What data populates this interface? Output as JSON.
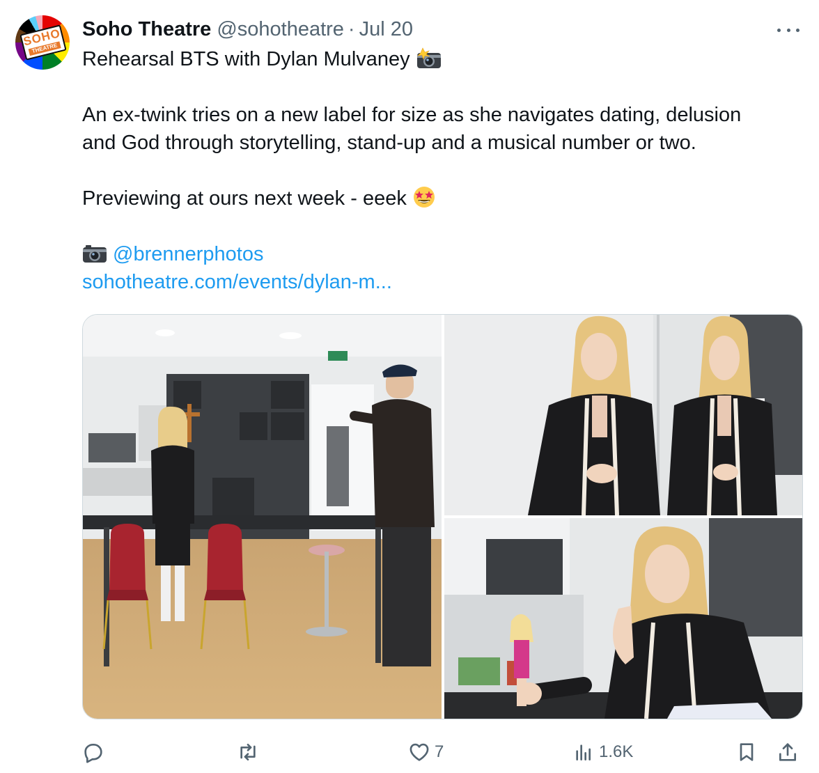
{
  "tweet": {
    "author_name": "Soho Theatre",
    "author_handle": "@sohotheatre",
    "separator": "·",
    "date": "Jul 20",
    "avatar_text_top": "SOHO",
    "avatar_text_bottom": "THEATRE",
    "line1": "Rehearsal BTS with Dylan Mulvaney",
    "line2": "An ex-twink tries on a new label for size as she navigates dating, delusion",
    "line3": "and God through storytelling, stand-up and a musical number or two.",
    "line4": "Previewing at ours next week - eeek",
    "mention": "@brennerphotos",
    "url": "sohotheatre.com/events/dylan-m...",
    "icons": {
      "line1_emoji": "camera-flash-icon",
      "line4_emoji": "star-struck-icon",
      "mention_emoji": "camera-icon"
    }
  },
  "media": {
    "photos": [
      {
        "name": "rehearsal-room-photo"
      },
      {
        "name": "mirror-portrait-photo"
      },
      {
        "name": "doll-table-photo"
      }
    ]
  },
  "actions": {
    "reply": {
      "icon": "reply-icon",
      "count": ""
    },
    "repost": {
      "icon": "repost-icon",
      "count": ""
    },
    "like": {
      "icon": "heart-icon",
      "count": "7"
    },
    "views": {
      "icon": "views-icon",
      "count": "1.6K"
    },
    "bookmark": {
      "icon": "bookmark-icon"
    },
    "share": {
      "icon": "share-icon"
    }
  },
  "colors": {
    "text": "#0f1419",
    "secondary": "#536471",
    "link": "#1d9bf0",
    "border": "#cfd9de"
  }
}
